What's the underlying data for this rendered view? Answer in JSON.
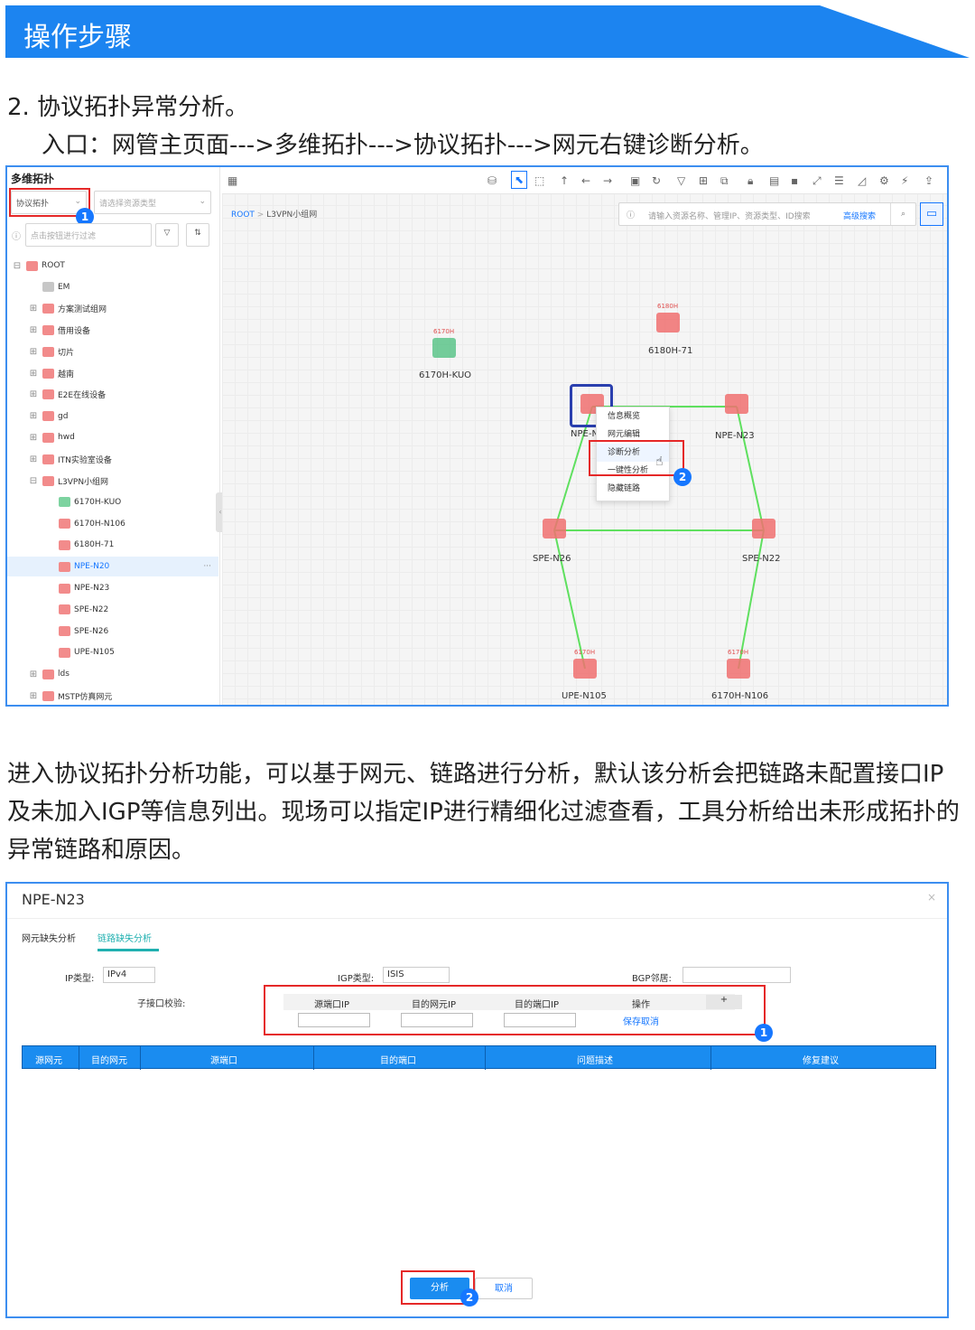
{
  "header": {
    "title": "操作步骤"
  },
  "step": {
    "heading": "2.  协议拓扑异常分析。",
    "entry": "入口：网管主页面--->多维拓扑--->协议拓扑--->网元右键诊断分析。"
  },
  "shot1": {
    "sidebar": {
      "title": "多维拓扑",
      "topology_select": "协议拓扑",
      "resource_select_placeholder": "请选择资源类型",
      "filter_placeholder": "点击按钮进行过滤",
      "tree": [
        {
          "label": "ROOT",
          "pm": "⊟",
          "icon": "red"
        },
        {
          "label": "EM",
          "pm": "",
          "icon": "gray"
        },
        {
          "label": "方案测试组网",
          "pm": "⊞",
          "icon": "red"
        },
        {
          "label": "借用设备",
          "pm": "⊞",
          "icon": "red"
        },
        {
          "label": "切片",
          "pm": "⊞",
          "icon": "red"
        },
        {
          "label": "越南",
          "pm": "⊞",
          "icon": "red"
        },
        {
          "label": "E2E在线设备",
          "pm": "⊞",
          "icon": "red"
        },
        {
          "label": "gd",
          "pm": "⊞",
          "icon": "red"
        },
        {
          "label": "hwd",
          "pm": "⊞",
          "icon": "red"
        },
        {
          "label": "ITN实验室设备",
          "pm": "⊞",
          "icon": "red"
        },
        {
          "label": "L3VPN小组网",
          "pm": "⊟",
          "icon": "red"
        },
        {
          "label": "6170H-KUO",
          "pm": "",
          "icon": "green"
        },
        {
          "label": "6170H-N106",
          "pm": "",
          "icon": "red"
        },
        {
          "label": "6180H-71",
          "pm": "",
          "icon": "red"
        },
        {
          "label": "NPE-N20",
          "pm": "",
          "icon": "red",
          "selected": true,
          "more": "···"
        },
        {
          "label": "NPE-N23",
          "pm": "",
          "icon": "red"
        },
        {
          "label": "SPE-N22",
          "pm": "",
          "icon": "red"
        },
        {
          "label": "SPE-N26",
          "pm": "",
          "icon": "red"
        },
        {
          "label": "UPE-N105",
          "pm": "",
          "icon": "red"
        },
        {
          "label": "lds",
          "pm": "⊞",
          "icon": "red"
        },
        {
          "label": "MSTP仿真网元",
          "pm": "⊞",
          "icon": "red"
        }
      ]
    },
    "breadcrumb": {
      "root": "ROOT",
      "sep": ">",
      "current": "L3VPN小组网"
    },
    "search": {
      "placeholder": "请输入资源名称、管理IP、资源类型、ID搜索",
      "advanced": "高级搜索"
    },
    "nodes": [
      {
        "label": "6170H-KUO",
        "tag": "6170H",
        "color": "#5cc48a"
      },
      {
        "label": "6180H-71",
        "tag": "6180H",
        "color": "#f07070"
      },
      {
        "label": "NPE-N20",
        "tag": "",
        "color": "#f07070"
      },
      {
        "label": "NPE-N23",
        "tag": "",
        "color": "#f07070"
      },
      {
        "label": "SPE-N26",
        "tag": "",
        "color": "#f07070"
      },
      {
        "label": "SPE-N22",
        "tag": "",
        "color": "#f07070"
      },
      {
        "label": "UPE-N105",
        "tag": "6170H",
        "color": "#f07070"
      },
      {
        "label": "6170H-N106",
        "tag": "6170H",
        "color": "#f07070"
      }
    ],
    "context_menu": [
      "信息概览",
      "网元编辑",
      "诊断分析",
      "一键性分析",
      "隐藏链路"
    ],
    "badges": [
      "1",
      "2"
    ]
  },
  "paragraph": "进入协议拓扑分析功能，可以基于网元、链路进行分析，默认该分析会把链路未配置接口IP及未加入IGP等信息列出。现场可以指定IP进行精细化过滤查看，工具分析给出未形成拓扑的异常链路和原因。",
  "shot2": {
    "dialog_title": "NPE-N23",
    "close": "×",
    "tabs": [
      "网元缺失分析",
      "链路缺失分析"
    ],
    "fields": {
      "ip_type_label": "IP类型:",
      "ip_type_value": "IPv4",
      "igp_label": "IGP类型:",
      "igp_value": "ISIS",
      "bgp_label": "BGP邻居:",
      "bgp_value": "",
      "subif_label": "子接口校验:"
    },
    "sub_table": {
      "headers": [
        "源端口IP",
        "目的网元IP",
        "目的端口IP",
        "操作"
      ],
      "add": "+",
      "row_action": "保存取消"
    },
    "table_headers": [
      "源网元",
      "目的网元",
      "源端口",
      "目的端口",
      "问题描述",
      "修复建议"
    ],
    "buttons": {
      "analyze": "分析",
      "cancel": "取消"
    },
    "badges": [
      "1",
      "2"
    ]
  }
}
